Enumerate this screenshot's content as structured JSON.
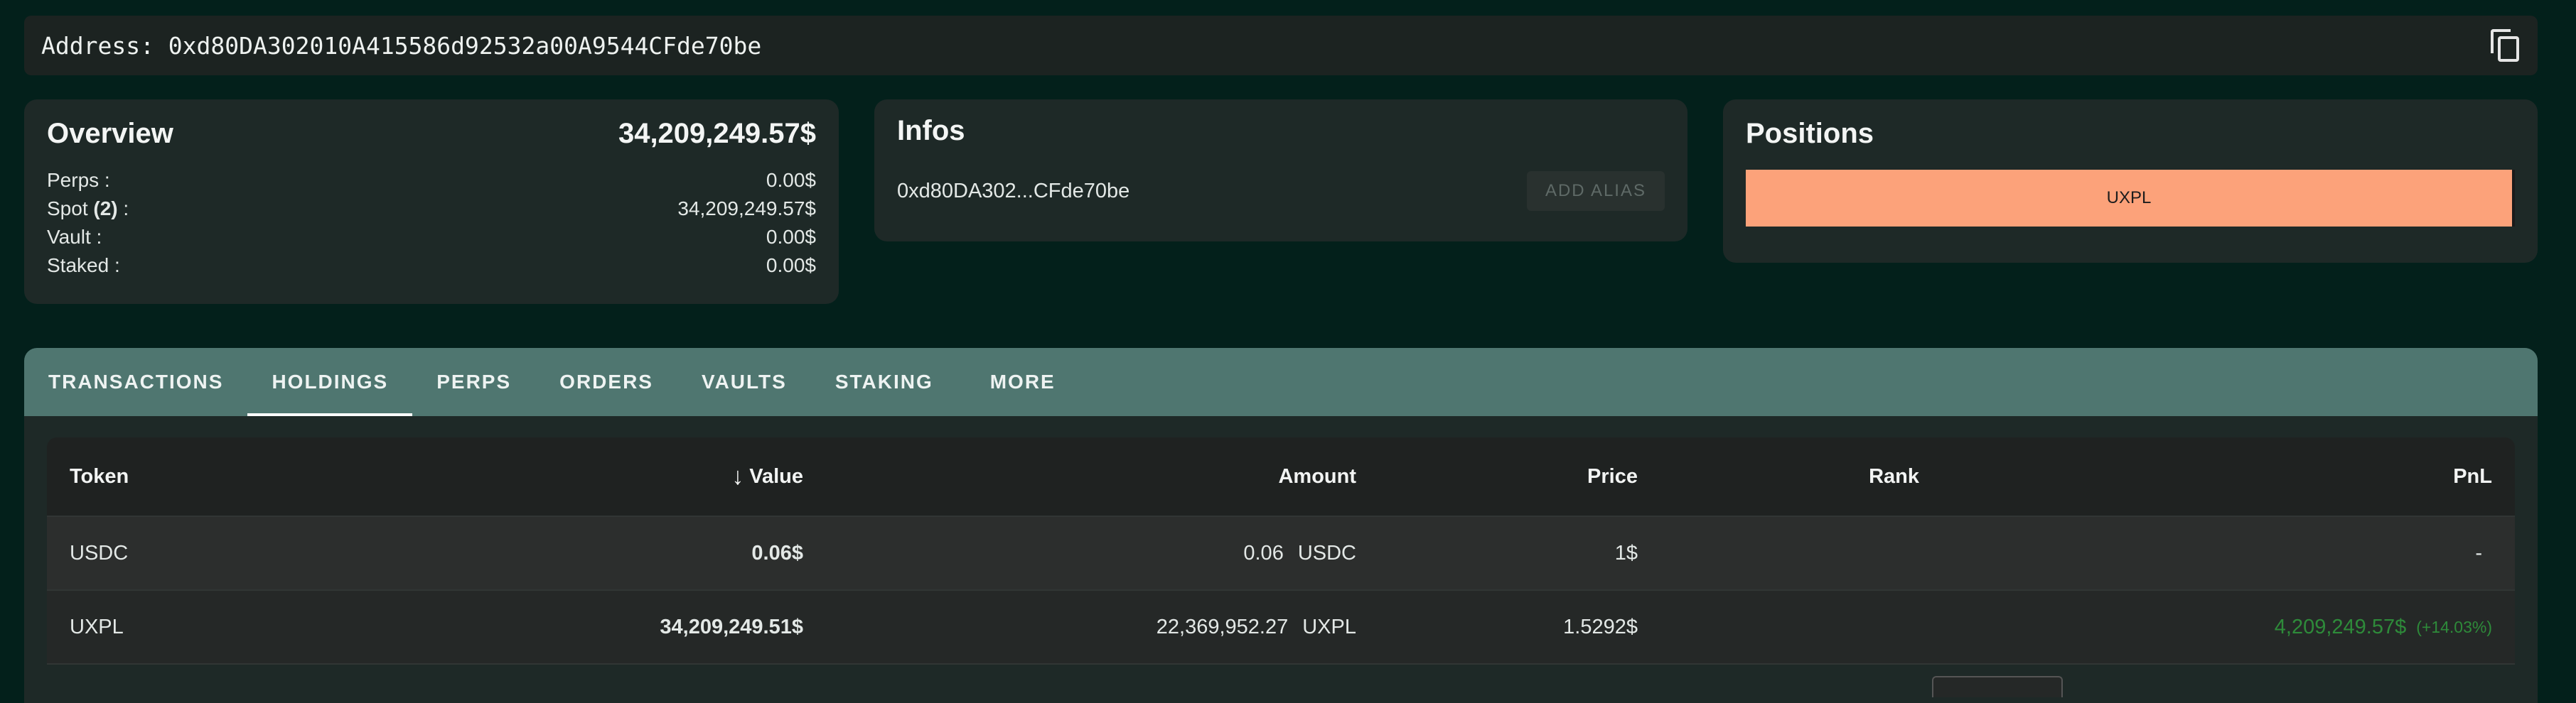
{
  "address_bar": {
    "label": "Address: 0xd80DA302010A415586d92532a00A9544CFde70be"
  },
  "overview": {
    "title": "Overview",
    "total": "34,209,249.57$",
    "rows": [
      {
        "label": "Perps :",
        "value": "0.00$"
      },
      {
        "label_prefix": "Spot ",
        "label_count": "(2)",
        "label_suffix": " :",
        "value": "34,209,249.57$"
      },
      {
        "label": "Vault :",
        "value": "0.00$"
      },
      {
        "label": "Staked :",
        "value": "0.00$"
      }
    ]
  },
  "infos": {
    "title": "Infos",
    "short_address": "0xd80DA302...CFde70be",
    "alias_button": "ADD ALIAS"
  },
  "positions": {
    "title": "Positions",
    "bar_label": "UXPL",
    "bar_share": 1.0,
    "bar_color": "#fca27a"
  },
  "tabs": [
    "TRANSACTIONS",
    "HOLDINGS",
    "PERPS",
    "ORDERS",
    "VAULTS",
    "STAKING",
    "MORE"
  ],
  "active_tab": "HOLDINGS",
  "table": {
    "headers": {
      "token": "Token",
      "value": "Value",
      "value_sort_icon": "arrow-down-icon",
      "amount": "Amount",
      "price": "Price",
      "rank": "Rank",
      "pnl": "PnL"
    },
    "rows": [
      {
        "token": "USDC",
        "value": "0.06$",
        "amount": "0.06",
        "unit": "USDC",
        "price": "1$",
        "rank": "",
        "pnl": "-",
        "pnl_pct": ""
      },
      {
        "token": "UXPL",
        "value": "34,209,249.51$",
        "amount": "22,369,952.27",
        "unit": "UXPL",
        "price": "1.5292$",
        "rank": "",
        "pnl": "4,209,249.57$",
        "pnl_pct": "(+14.03%)"
      }
    ]
  },
  "colors": {
    "background": "#03201b",
    "card": "#1e2927",
    "tab_bar": "#4f7670",
    "positive": "#2e8b3a"
  }
}
